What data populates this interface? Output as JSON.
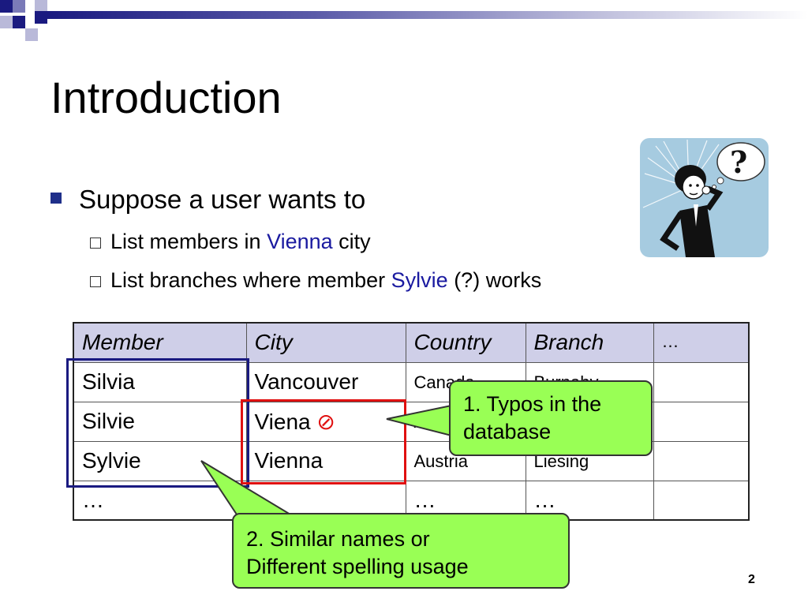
{
  "slide": {
    "title": "Introduction",
    "bullet": "Suppose a user wants to",
    "sub1": {
      "prefix": "List members in ",
      "highlight": "Vienna",
      "suffix": " city"
    },
    "sub2": {
      "prefix": "List branches where member ",
      "highlight": "Sylvie",
      "suffix": " (?) works"
    },
    "page_number": "2"
  },
  "table": {
    "headers": [
      "Member",
      "City",
      "Country",
      "Branch",
      "…"
    ],
    "rows": [
      [
        "Silvia",
        "Vancouver",
        "Canada",
        "Burnaby",
        ""
      ],
      [
        "Silvie",
        "Viena",
        "Austria",
        "",
        ""
      ],
      [
        "Sylvie",
        "Vienna",
        "Austria",
        "Liesing",
        ""
      ],
      [
        "…",
        "…",
        "…",
        "…",
        ""
      ]
    ],
    "prohibited_symbol": "⊘"
  },
  "callouts": {
    "typos_line1": "1. Typos in the",
    "typos_line2": "database",
    "similar_line1": "2. Similar names or",
    "similar_line2": "Different spelling usage"
  },
  "colors": {
    "accent": "#1a1aa0",
    "callout": "#99ff55",
    "header_bg": "#cfcfe8",
    "blue_frame": "#1a1a80",
    "red_frame": "#e01010"
  }
}
